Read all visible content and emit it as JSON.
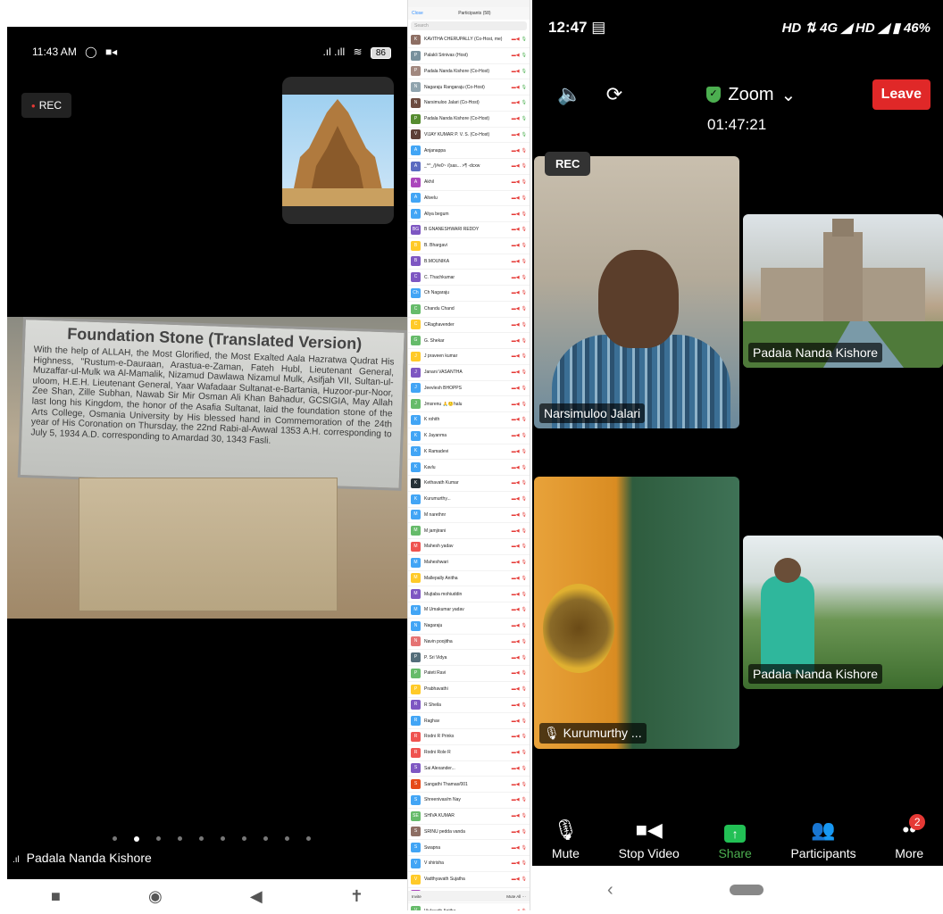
{
  "left": {
    "status_time": "11:43 AM",
    "battery": "86",
    "rec_label": "REC",
    "plaque_title": "Foundation Stone (Translated Version)",
    "plaque_text": "With the help of ALLAH, the Most Glorified, the Most Exalted Aala Hazratwa Qudrat His Highness, \"Rustum-e-Dauraan, Arastua-e-Zaman, Fateh Hubl, Lieutenant General, Muzaffar-ul-Mulk wa Al-Mamalik, Nizamud Dawlawa Nizamul Mulk, Asifjah VII, Sultan-ul-uloom, H.E.H. Lieutenant General, Yaar Wafadaar Sultanat-e-Bartania, Huzoor-pur-Noor, Zee Shan, Zille Subhan, Nawab Sir Mir Osman Ali Khan Bahadur, GCSIGIA, May Allah last long his Kingdom, the honor of the Asafia Sultanat, laid the foundation stone of the Arts College, Osmania University by His blessed hand in Commemoration of the 24th year of His Coronation on Thursday, the 22nd Rabi-al-Awwal 1353 A.H. corresponding to July 5, 1934 A.D. corresponding to Amardad 30, 1343 Fasli.",
    "speaker_name": "Padala Nanda Kishore"
  },
  "participants": {
    "title": "Participants (58)",
    "close_label": "Close",
    "search_placeholder": "Search",
    "invite_label": "Invite",
    "mute_all_label": "Mute All",
    "more_label": "···",
    "list": [
      {
        "initial": "K",
        "name": "KAVITHA CHERUPALLY (Co-Host, me)",
        "color": "#8d6e63"
      },
      {
        "initial": "P",
        "name": "Palakli Srinivas (Host)",
        "color": "#78909c"
      },
      {
        "initial": "P",
        "name": "Padala Nanda Kishore (Co-Host)",
        "color": "#a1887f"
      },
      {
        "initial": "N",
        "name": "Nagaraju Rangaraju (Co-Host)",
        "color": "#90a4ae"
      },
      {
        "initial": "N",
        "name": "Narsimuloo Jalari (Co-Host)",
        "color": "#6d4c41"
      },
      {
        "initial": "P",
        "name": "Padala Nanda Kishore (Co-Host)",
        "color": "#558b2f"
      },
      {
        "initial": "V",
        "name": "VIJAY KUMAR P. V. S. (Co-Host)",
        "color": "#5d4037"
      },
      {
        "initial": "A",
        "name": "Anjanappa",
        "color": "#42a5f5"
      },
      {
        "initial": "A",
        "name": "_^^_/(#e0~ /(sas... >¶ -dcxw",
        "color": "#5c6bc0"
      },
      {
        "initial": "A",
        "name": "Akhil",
        "color": "#ab47bc"
      },
      {
        "initial": "A",
        "name": "Alivelu",
        "color": "#42a5f5"
      },
      {
        "initial": "A",
        "name": "Aliya begum",
        "color": "#42a5f5"
      },
      {
        "initial": "BG",
        "name": "B GNANESHWARI REDDY",
        "color": "#7e57c2"
      },
      {
        "initial": "B",
        "name": "B. Bhargavi",
        "color": "#ffca28"
      },
      {
        "initial": "B",
        "name": "B.MOUNIKA",
        "color": "#7e57c2"
      },
      {
        "initial": "C",
        "name": "C. Thachkumar",
        "color": "#7e57c2"
      },
      {
        "initial": "Ch",
        "name": "Ch Nagaraju",
        "color": "#42a5f5"
      },
      {
        "initial": "C",
        "name": "Chandu Chand",
        "color": "#66bb6a"
      },
      {
        "initial": "C",
        "name": "CRaghavender",
        "color": "#ffca28"
      },
      {
        "initial": "G",
        "name": "G. Shekar",
        "color": "#66bb6a"
      },
      {
        "initial": "J",
        "name": "J praveen kumar",
        "color": "#ffca28"
      },
      {
        "initial": "J",
        "name": "Janani VASANTHA",
        "color": "#7e57c2"
      },
      {
        "initial": "J",
        "name": "Jeevlesh BHOPPS",
        "color": "#42a5f5"
      },
      {
        "initial": "J",
        "name": "Jmsrenu 🙏🙂halu",
        "color": "#66bb6a"
      },
      {
        "initial": "K",
        "name": "K rohith",
        "color": "#42a5f5"
      },
      {
        "initial": "K",
        "name": "K Jayanma",
        "color": "#42a5f5"
      },
      {
        "initial": "K",
        "name": "K Ramadevi",
        "color": "#42a5f5"
      },
      {
        "initial": "K",
        "name": "Kavlu",
        "color": "#42a5f5"
      },
      {
        "initial": "K",
        "name": "Kethavath Kumar",
        "color": "#263238"
      },
      {
        "initial": "K",
        "name": "Kurumurthy...",
        "color": "#42a5f5"
      },
      {
        "initial": "M",
        "name": "M narethnr",
        "color": "#42a5f5"
      },
      {
        "initial": "M",
        "name": "M jamjirani",
        "color": "#66bb6a"
      },
      {
        "initial": "M",
        "name": "Mahesh yadav",
        "color": "#ef5350"
      },
      {
        "initial": "M",
        "name": "Maheshwari",
        "color": "#42a5f5"
      },
      {
        "initial": "M",
        "name": "Mallepally Anitha",
        "color": "#ffca28"
      },
      {
        "initial": "M",
        "name": "Mujtaba mohiuddin",
        "color": "#7e57c2"
      },
      {
        "initial": "M",
        "name": "M Umakumar yadav",
        "color": "#42a5f5"
      },
      {
        "initial": "N",
        "name": "Nagaraju",
        "color": "#42a5f5"
      },
      {
        "initial": "N",
        "name": "Navin poojitha",
        "color": "#e57373"
      },
      {
        "initial": "P",
        "name": "P. Sri Vidya",
        "color": "#546e7a"
      },
      {
        "initial": "P",
        "name": "Pateti Ravi",
        "color": "#66bb6a"
      },
      {
        "initial": "P",
        "name": "Prabhavathi",
        "color": "#ffca28"
      },
      {
        "initial": "R",
        "name": "R Sheila",
        "color": "#7e57c2"
      },
      {
        "initial": "R",
        "name": "Raghav",
        "color": "#42a5f5"
      },
      {
        "initial": "R",
        "name": "Rodni R Prinks",
        "color": "#ef5350"
      },
      {
        "initial": "R",
        "name": "Rodni Role R",
        "color": "#ef5350"
      },
      {
        "initial": "S",
        "name": "Sai Alexander...",
        "color": "#7e57c2"
      },
      {
        "initial": "S",
        "name": "Sangathi Thamas/001",
        "color": "#e64a19"
      },
      {
        "initial": "S",
        "name": "Shreenivas/m Nay",
        "color": "#42a5f5"
      },
      {
        "initial": "SE",
        "name": "SHIVA KUMAR",
        "color": "#66bb6a"
      },
      {
        "initial": "S",
        "name": "SRINU pedda vanda",
        "color": "#8d6e63"
      },
      {
        "initial": "S",
        "name": "Swapna",
        "color": "#42a5f5"
      },
      {
        "initial": "V",
        "name": "V shirisha",
        "color": "#42a5f5"
      },
      {
        "initial": "V",
        "name": "Vadthyavath Sujatha",
        "color": "#ffca28"
      },
      {
        "initial": "V",
        "name": "Vijaalaxmi",
        "color": "#ab47bc"
      },
      {
        "initial": "V",
        "name": "Vivlavath Anitha",
        "color": "#66bb6a"
      },
      {
        "initial": "మ",
        "name": "చదెన్నితన అంబానేదేవులు చదివండి",
        "color": "#8d6e63"
      },
      {
        "initial": "M",
        "name": "Mote Chaitanya",
        "color": "#43a047"
      }
    ]
  },
  "right": {
    "status_time": "12:47",
    "status_right": "HD ⇅ 4G ◢ HD ◢ ▮ 46%",
    "zoom_label": "Zoom",
    "leave_label": "Leave",
    "call_time": "01:47:21",
    "rec_label": "REC",
    "tiles": {
      "narsimuloo": "Narsimuloo Jalari",
      "osmania1": "Padala Nanda Kishore",
      "kurumurthy": "Kurumurthy ...",
      "osmania2": "Padala Nanda Kishore"
    },
    "bottom": {
      "mute": "Mute",
      "stop_video": "Stop Video",
      "share": "Share",
      "participants": "Participants",
      "more": "More",
      "more_badge": "2"
    }
  }
}
